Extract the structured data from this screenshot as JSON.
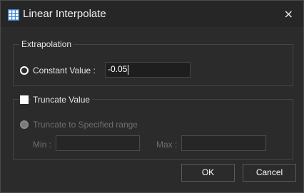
{
  "window": {
    "title": "Linear Interpolate",
    "close_label": "×"
  },
  "extrapolation": {
    "group_label": "Extrapolation",
    "constant_label": "Constant Value :",
    "constant_value": "-0.05",
    "constant_selected": true
  },
  "truncate": {
    "checkbox_label": "Truncate Value",
    "checked": false,
    "range_label": "Truncate to Specified range",
    "min_label": "Min :",
    "min_value": "",
    "max_label": "Max :",
    "max_value": ""
  },
  "buttons": {
    "ok_label": "OK",
    "cancel_label": "Cancel"
  },
  "colors": {
    "icon_blue": "#4a90d9"
  }
}
